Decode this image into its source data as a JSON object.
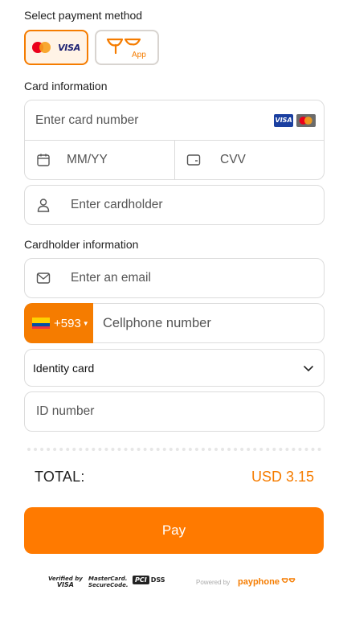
{
  "payment_method": {
    "label": "Select payment method",
    "card_option_label": "VISA",
    "app_option_label": "App"
  },
  "card_info": {
    "label": "Card information",
    "card_number_placeholder": "Enter card number",
    "badge_visa": "VISA",
    "expiry_placeholder": "MM/YY",
    "cvv_placeholder": "CVV",
    "cardholder_placeholder": "Enter cardholder"
  },
  "cardholder_info": {
    "label": "Cardholder information",
    "email_placeholder": "Enter an email",
    "phone_prefix": "+593",
    "phone_placeholder": "Cellphone number",
    "id_type_selected": "Identity card",
    "id_number_placeholder": "ID number"
  },
  "summary": {
    "total_label": "TOTAL:",
    "total_value": "USD 3.15"
  },
  "pay_button_label": "Pay",
  "footer": {
    "verified_visa_line1": "Verified by",
    "verified_visa_line2": "VISA",
    "mastercard_line1": "MasterCard.",
    "mastercard_line2": "SecureCode.",
    "pci_label": "PCI",
    "dss_label": "DSS",
    "powered_by": "Powered by",
    "brand": "payphone"
  },
  "colors": {
    "accent": "#f57c00",
    "pay_button": "#ff7a00",
    "border": "#dcdcdc"
  }
}
